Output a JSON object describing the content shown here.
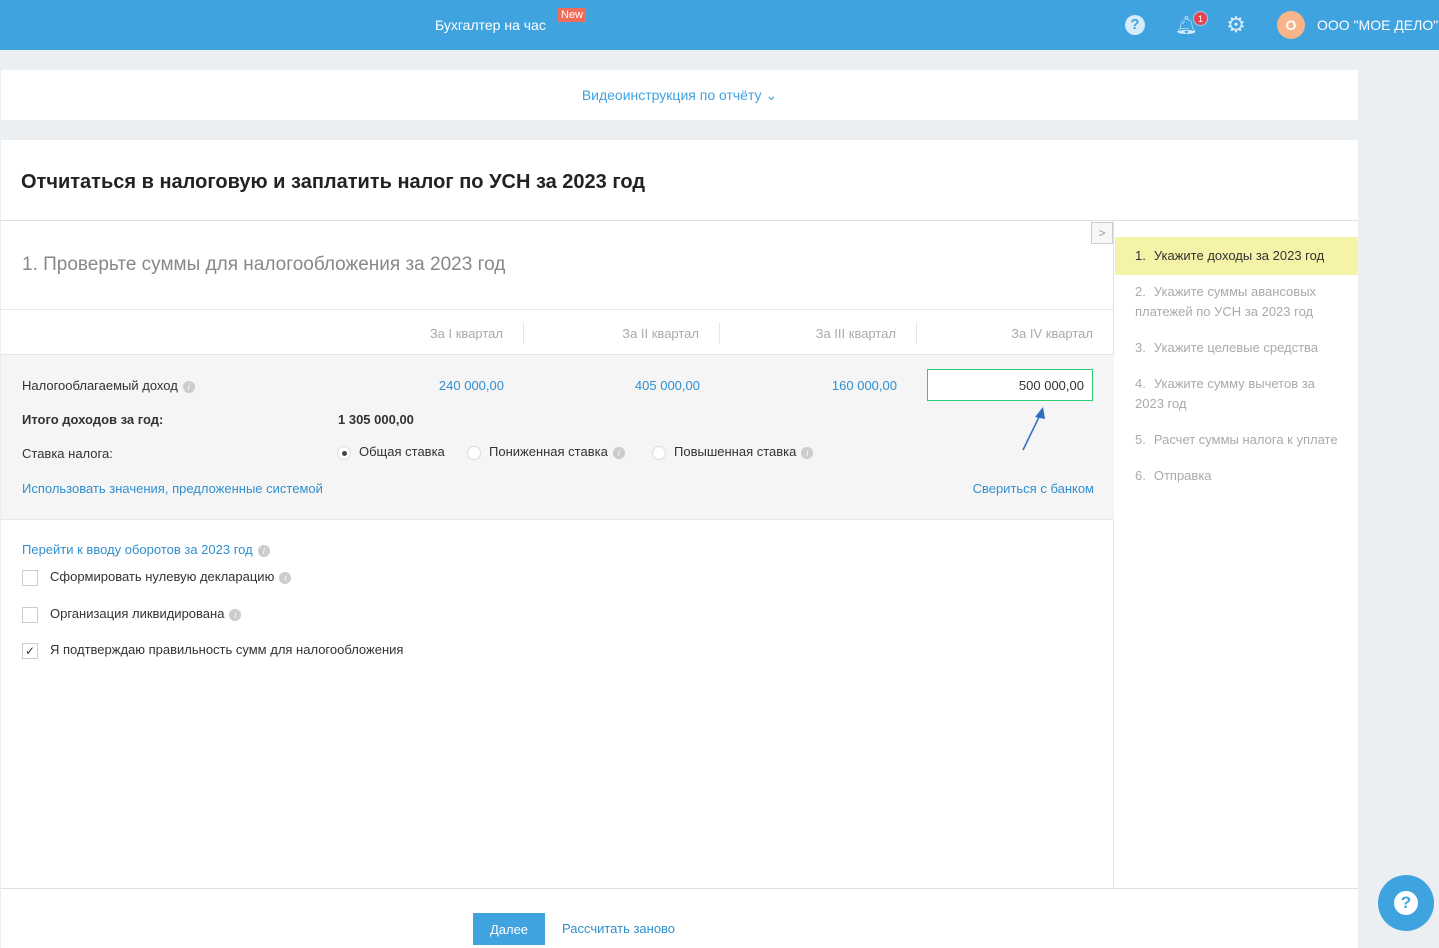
{
  "header": {
    "brand": "Бухгалтер на час",
    "new_badge": "New",
    "notifications_count": "1",
    "avatar_letter": "О",
    "org_name": "ООО \"МОЕ ДЕЛО\""
  },
  "video": {
    "label": "Видеоинструкция по отчёту",
    "chevron": "⌄"
  },
  "page": {
    "title": "Отчитаться в налоговую и заплатить налог по УСН за 2023 год"
  },
  "section": {
    "title": "1. Проверьте суммы для налогообложения за 2023 год"
  },
  "quarters": [
    "За I квартал",
    "За II квартал",
    "За III квартал",
    "За IV квартал"
  ],
  "income": {
    "label": "Налогооблагаемый доход",
    "values": [
      "240 000,00",
      "405 000,00",
      "160 000,00"
    ],
    "q4_input": "500 000,00"
  },
  "total": {
    "label": "Итого доходов за год:",
    "value": "1 305 000,00"
  },
  "rate": {
    "label": "Ставка налога:",
    "options": [
      "Общая ставка",
      "Пониженная ставка",
      "Повышенная ставка"
    ],
    "selected": 0
  },
  "links": {
    "use_system": "Использовать значения, предложенные системой",
    "bank": "Свериться с банком",
    "turnover": "Перейти к вводу оборотов за 2023 год"
  },
  "checkboxes": [
    {
      "label": "Сформировать нулевую декларацию",
      "checked": false
    },
    {
      "label": "Организация ликвидирована",
      "checked": false
    },
    {
      "label": "Я подтверждаю правильность сумм для налогообложения",
      "checked": true
    }
  ],
  "steps": [
    {
      "n": "1.",
      "label": "Укажите доходы за 2023 год"
    },
    {
      "n": "2.",
      "label": "Укажите суммы авансовых платежей по УСН за 2023 год"
    },
    {
      "n": "3.",
      "label": "Укажите целевые средства"
    },
    {
      "n": "4.",
      "label": "Укажите сумму вычетов за 2023 год"
    },
    {
      "n": "5.",
      "label": "Расчет суммы налога к уплате"
    },
    {
      "n": "6.",
      "label": "Отправка"
    }
  ],
  "footer": {
    "next": "Далее",
    "recalc": "Рассчитать заново"
  },
  "colors": {
    "brand": "#3ea3df",
    "active_step": "#f5f3a8",
    "input_border": "#2ecc71"
  }
}
